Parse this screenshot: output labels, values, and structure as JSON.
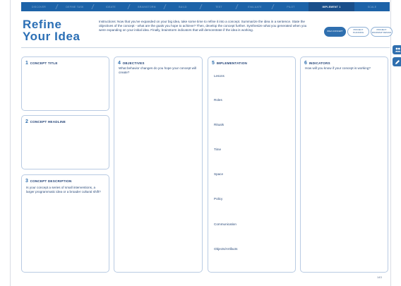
{
  "breadcrumb": {
    "items": [
      "Discover",
      "Define Task",
      "Ideate",
      "Brainstorm",
      "Build",
      "Test",
      "Evaluate",
      "Pilot",
      "Implement 1",
      "Scale"
    ],
    "active_index": 8
  },
  "title": {
    "line1": "Refine",
    "line2": "Your Idea"
  },
  "instructions": "Instructions: Now that you've expanded on your big idea, take some time to refine it into a concept. Summarize the idea in a sentence. State the objectives of the concept - what are the goals you hope to achieve? Then, develop the concept further. Synthesize what you generated when you were expanding on your initial idea. Finally, brainstorm indicators that will demonstrate if the idea is working.",
  "pills": [
    {
      "label": "Idea Concept",
      "active": true
    },
    {
      "label": "Project Planning",
      "active": false
    },
    {
      "label": "Project Roadmap Design",
      "active": false
    }
  ],
  "side_icons": [
    "people-icon",
    "pencil-icon"
  ],
  "cards": {
    "concept_title": {
      "num": "1",
      "label": "Concept Title"
    },
    "concept_headline": {
      "num": "2",
      "label": "Concept Headline"
    },
    "concept_description": {
      "num": "3",
      "label": "Concept Description",
      "prompt": "Is your concept a series of small interventions, a larger programmatic idea or a broader cultural shift?"
    },
    "objectives": {
      "num": "4",
      "label": "Objectives",
      "prompt": "What behavior changes do you hope your concept will create?"
    },
    "implementation": {
      "num": "5",
      "label": "Implementation",
      "items": [
        "Lesons",
        "Roles",
        "Rituals",
        "Time",
        "Space",
        "Policy",
        "Communication",
        "Objects/Artifacts"
      ]
    },
    "indicators": {
      "num": "6",
      "label": "Indicators",
      "prompt": "How will you know if your concept is working?"
    }
  },
  "page_number": "143"
}
